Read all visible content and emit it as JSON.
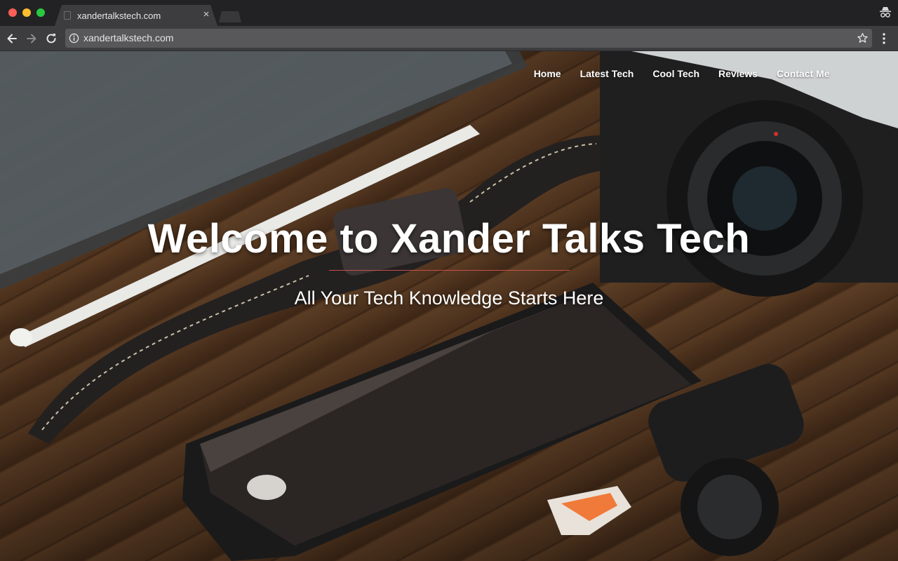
{
  "browser": {
    "tab_title": "xandertalkstech.com",
    "tab_close": "×",
    "url": "xandertalkstech.com",
    "icons": [
      "page-icon",
      "close-icon",
      "incognito-icon",
      "back-arrow-icon",
      "forward-arrow-icon",
      "reload-icon",
      "info-icon",
      "star-icon",
      "menu-icon"
    ]
  },
  "site": {
    "nav": [
      "Home",
      "Latest Tech",
      "Cool Tech",
      "Reviews",
      "Contact Me"
    ],
    "hero_title": "Welcome to Xander Talks Tech",
    "hero_subtitle": "All Your Tech Knowledge Starts Here",
    "divider_color": "#c9504a"
  },
  "colors": {
    "tabbar": "#222224",
    "toolbar": "#3d3d40",
    "omnibox": "#58585b"
  }
}
